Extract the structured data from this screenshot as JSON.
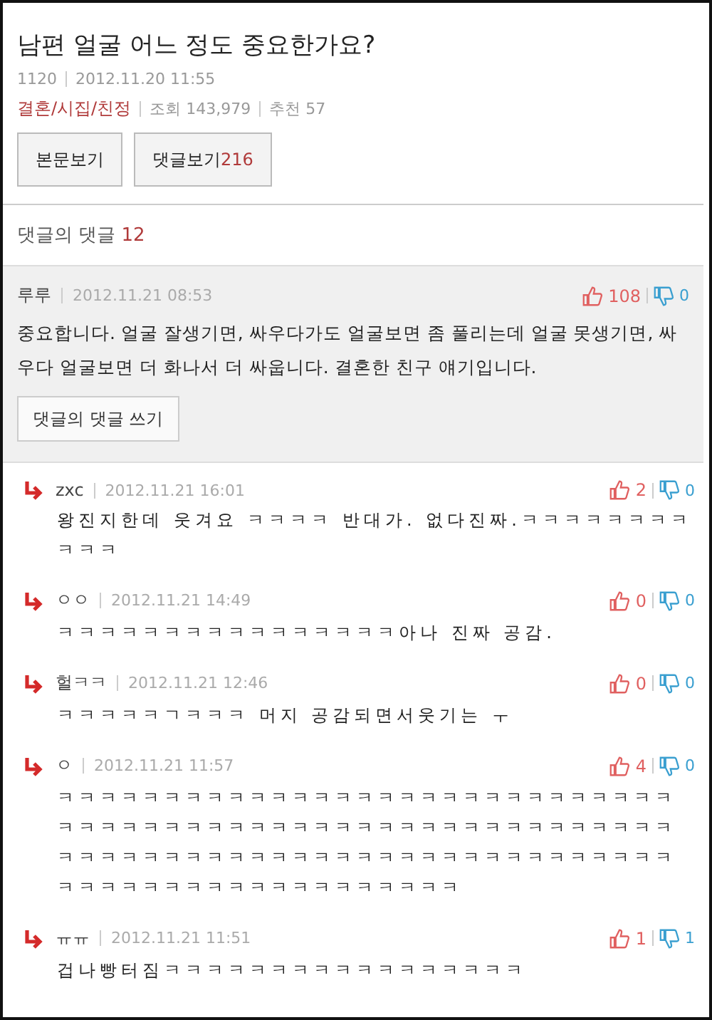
{
  "post": {
    "title": "남편 얼굴 어느 정도 중요한가요?",
    "author": "1120",
    "date": "2012.11.20 11:55",
    "category": "결혼/시집/친정",
    "views": "조회 143,979",
    "recommend": "추천 57"
  },
  "buttons": [
    {
      "label": "본문보기"
    },
    {
      "label": "댓글보기",
      "count": "216"
    }
  ],
  "replies_header": {
    "label": "댓글의 댓글",
    "count": "12"
  },
  "comment": {
    "author": "루루",
    "date": "2012.11.21 08:53",
    "likes": "108",
    "dislikes": "0",
    "text": "중요합니다. 얼굴 잘생기면, 싸우다가도 얼굴보면 좀 풀리는데 얼굴 못생기면, 싸우다 얼굴보면 더 화나서 더 싸웁니다. 결혼한 친구 얘기입니다.",
    "reply_button": "댓글의 댓글 쓰기"
  },
  "replies": [
    {
      "author": "zxc",
      "date": "2012.11.21 16:01",
      "likes": "2",
      "dislikes": "0",
      "text": "왕진지한데 웃겨요 ㅋㅋㅋㅋ 반대가. 없다진짜.ㅋㅋㅋㅋㅋㅋㅋㅋㅋㅋㅋ"
    },
    {
      "author": "ㅇㅇ",
      "date": "2012.11.21 14:49",
      "likes": "0",
      "dislikes": "0",
      "text": "ㅋㅋㅋㅋㅋㅋㅋㅋㅋㅋㅋㅋㅋㅋㅋㅋ아나 진짜 공감."
    },
    {
      "author": "헐ㅋㅋ",
      "date": "2012.11.21 12:46",
      "likes": "0",
      "dislikes": "0",
      "text": "ㅋㅋㅋㅋㅋㄱㅋㅋㅋ 머지 공감되면서웃기는 ㅜ"
    },
    {
      "author": "ㅇ",
      "date": "2012.11.21 11:57",
      "likes": "4",
      "dislikes": "0",
      "text": "ㅋㅋㅋㅋㅋㅋㅋㅋㅋㅋㅋㅋㅋㅋㅋㅋㅋㅋㅋㅋㅋㅋㅋㅋㅋㅋㅋㅋㅋㅋㅋㅋㅋㅋㅋㅋㅋㅋㅋㅋㅋㅋㅋㅋㅋㅋㅋㅋㅋㅋㅋㅋㅋㅋㅋㅋㅋㅋㅋㅋㅋㅋㅋㅋㅋㅋㅋㅋㅋㅋㅋㅋㅋㅋㅋㅋㅋㅋㅋㅋㅋㅋㅋㅋㅋㅋㅋㅋㅋㅋㅋㅋㅋㅋㅋㅋㅋㅋㅋㅋㅋㅋㅋㅋㅋㅋ"
    },
    {
      "author": "ㅠㅠ",
      "date": "2012.11.21 11:51",
      "likes": "1",
      "dislikes": "1",
      "text": "겁나빵터짐ㅋㅋㅋㅋㅋㅋㅋㅋㅋㅋㅋㅋㅋㅋㅋㅋㅋ"
    }
  ]
}
